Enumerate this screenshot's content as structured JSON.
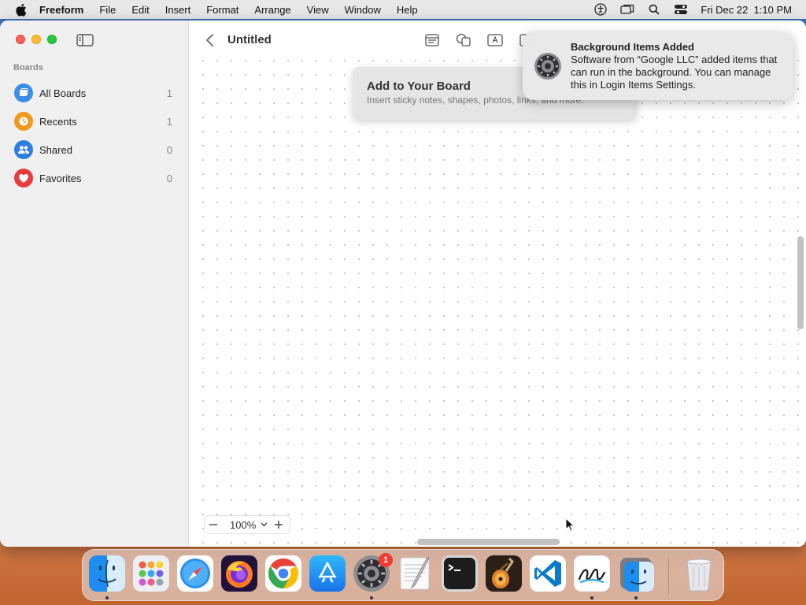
{
  "menubar": {
    "app_name": "Freeform",
    "items": [
      "File",
      "Edit",
      "Insert",
      "Format",
      "Arrange",
      "View",
      "Window",
      "Help"
    ],
    "datetime": "Fri Dec 22  1:10 PM"
  },
  "window": {
    "title": "Untitled"
  },
  "sidebar": {
    "heading": "Boards",
    "items": [
      {
        "label": "All Boards",
        "count": "1",
        "icon": "all-boards-icon",
        "color": "#3a8ee6"
      },
      {
        "label": "Recents",
        "count": "1",
        "icon": "clock-icon",
        "color": "#f19a1a"
      },
      {
        "label": "Shared",
        "count": "0",
        "icon": "people-icon",
        "color": "#2f7de1"
      },
      {
        "label": "Favorites",
        "count": "0",
        "icon": "heart-icon",
        "color": "#ea3a3a"
      }
    ]
  },
  "tip": {
    "title": "Add to Your Board",
    "subtitle": "Insert sticky notes, shapes, photos, links, and more."
  },
  "zoom": {
    "value": "100%"
  },
  "notification": {
    "title": "Background Items Added",
    "body": "Software from “Google LLC” added items that can run in the background. You can manage this in Login Items Settings."
  },
  "dock": {
    "apps": [
      {
        "name": "Finder",
        "icon": "finder-icon",
        "running": true
      },
      {
        "name": "Launchpad",
        "icon": "launchpad-icon",
        "running": false
      },
      {
        "name": "Safari",
        "icon": "safari-icon",
        "running": false
      },
      {
        "name": "Firefox",
        "icon": "firefox-icon",
        "running": false
      },
      {
        "name": "Chrome",
        "icon": "chrome-icon",
        "running": false
      },
      {
        "name": "App Store",
        "icon": "app-store-icon",
        "running": false
      },
      {
        "name": "System Settings",
        "icon": "system-settings-icon",
        "running": true,
        "badge": "1"
      },
      {
        "name": "TextEdit",
        "icon": "textedit-icon",
        "running": false
      },
      {
        "name": "Terminal",
        "icon": "terminal-icon",
        "running": false
      },
      {
        "name": "GarageBand",
        "icon": "garageband-icon",
        "running": false
      },
      {
        "name": "VS Code",
        "icon": "vscode-icon",
        "running": false
      },
      {
        "name": "Freeform",
        "icon": "freeform-icon",
        "running": true
      },
      {
        "name": "Finder Copy",
        "icon": "finder-copy-icon",
        "running": true
      },
      {
        "name": "Trash",
        "icon": "trash-icon",
        "running": false
      }
    ]
  }
}
